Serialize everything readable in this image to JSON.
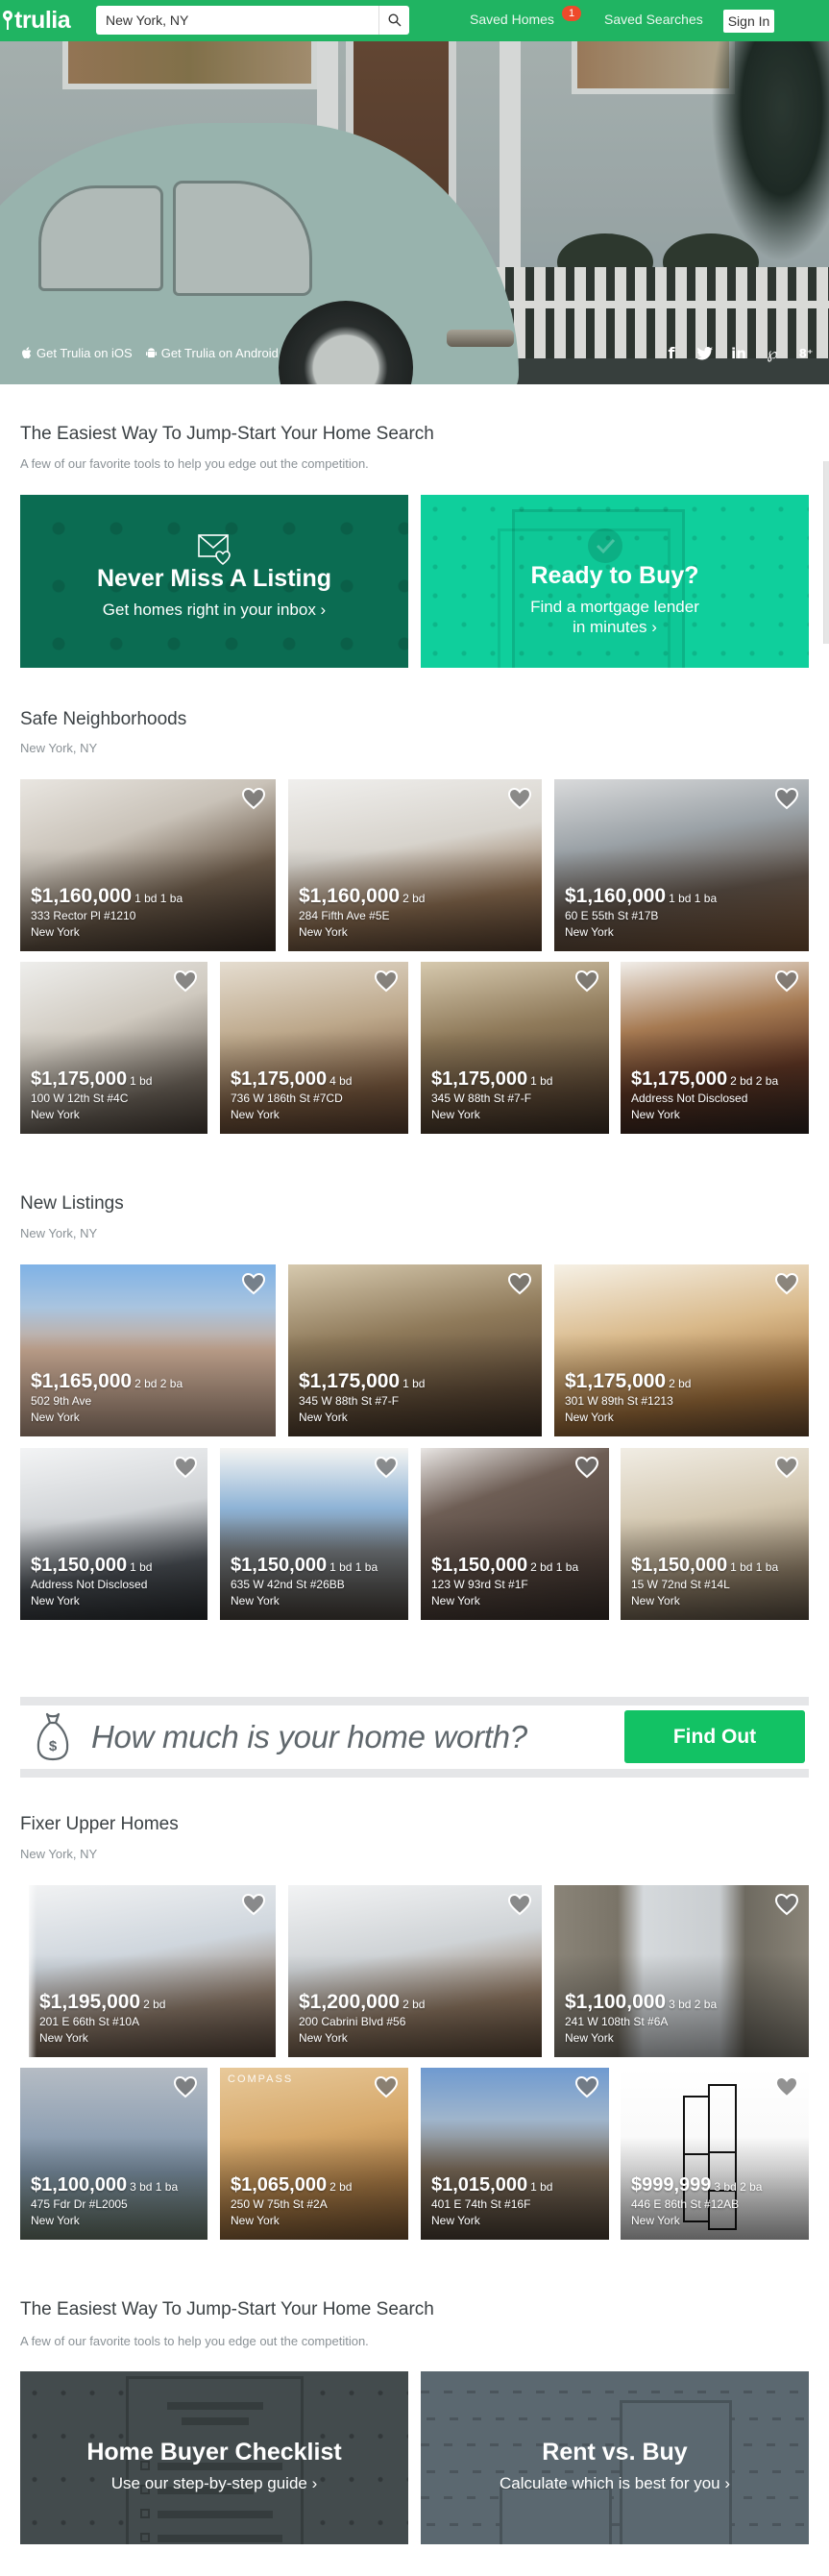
{
  "header": {
    "logo": "trulia",
    "search_value": "New York, NY",
    "search_placeholder": "Search",
    "saved_homes_label": "Saved Homes",
    "saved_homes_count": "1",
    "saved_searches_label": "Saved Searches",
    "sign_in_label": "Sign In",
    "brand_color": "#20b462"
  },
  "hero": {
    "ios_link": "Get Trulia on iOS",
    "android_link": "Get Trulia on Android",
    "social": [
      {
        "icon": "facebook-icon",
        "glyph": "f"
      },
      {
        "icon": "twitter-icon",
        "glyph": "t"
      },
      {
        "icon": "linkedin-icon",
        "glyph": "in"
      },
      {
        "icon": "pinterest-icon",
        "glyph": "P"
      },
      {
        "icon": "google-plus-icon",
        "glyph": "g+"
      }
    ]
  },
  "tools_top": {
    "title": "The Easiest Way To Jump-Start Your Home Search",
    "subtitle": "A few of our favorite tools to help you edge out the competition.",
    "cards": [
      {
        "title": "Never Miss A Listing",
        "subtitle": "Get homes right in your inbox ›",
        "icon": "mail-heart-icon",
        "color": "#0b6c52"
      },
      {
        "title": "Ready to Buy?",
        "subtitle_line1": "Find a mortgage lender",
        "subtitle_line2": "in minutes ›",
        "icon": "check-icon",
        "color": "#0fcf9c"
      }
    ]
  },
  "safe_neighborhoods": {
    "title": "Safe Neighborhoods",
    "subtitle": "New York, NY",
    "listings": [
      {
        "price": "$1,160,000",
        "beds": "1 bd 1 ba",
        "address": "333 Rector Pl #1210",
        "city": "New York"
      },
      {
        "price": "$1,160,000",
        "beds": "2 bd",
        "address": "284 Fifth Ave #5E",
        "city": "New York"
      },
      {
        "price": "$1,160,000",
        "beds": "1 bd 1 ba",
        "address": "60 E 55th St #17B",
        "city": "New York"
      },
      {
        "price": "$1,175,000",
        "beds": "1 bd",
        "address": "100 W 12th St #4C",
        "city": "New York"
      },
      {
        "price": "$1,175,000",
        "beds": "4 bd",
        "address": "736 W 186th St #7CD",
        "city": "New York"
      },
      {
        "price": "$1,175,000",
        "beds": "1 bd",
        "address": "345 W 88th St #7-F",
        "city": "New York"
      },
      {
        "price": "$1,175,000",
        "beds": "2 bd 2 ba",
        "address": "Address Not Disclosed",
        "city": "New York"
      }
    ]
  },
  "new_listings": {
    "title": "New Listings",
    "subtitle": "New York, NY",
    "listings": [
      {
        "price": "$1,165,000",
        "beds": "2 bd 2 ba",
        "address": "502 9th Ave",
        "city": "New York"
      },
      {
        "price": "$1,175,000",
        "beds": "1 bd",
        "address": "345 W 88th St #7-F",
        "city": "New York"
      },
      {
        "price": "$1,175,000",
        "beds": "2 bd",
        "address": "301 W 89th St #1213",
        "city": "New York"
      },
      {
        "price": "$1,150,000",
        "beds": "1 bd",
        "address": "Address Not Disclosed",
        "city": "New York"
      },
      {
        "price": "$1,150,000",
        "beds": "1 bd 1 ba",
        "address": "635 W 42nd St #26BB",
        "city": "New York"
      },
      {
        "price": "$1,150,000",
        "beds": "2 bd 1 ba",
        "address": "123 W 93rd St #1F",
        "city": "New York"
      },
      {
        "price": "$1,150,000",
        "beds": "1 bd 1 ba",
        "address": "15 W 72nd St #14L",
        "city": "New York"
      }
    ]
  },
  "banner": {
    "question": "How much is your home worth?",
    "button_label": "Find Out",
    "button_color": "#12c264"
  },
  "fixer_upper": {
    "title": "Fixer Upper Homes",
    "subtitle": "New York, NY",
    "listings": [
      {
        "price": "$1,195,000",
        "beds": "2 bd",
        "address": "201 E 66th St #10A",
        "city": "New York"
      },
      {
        "price": "$1,200,000",
        "beds": "2 bd",
        "address": "200 Cabrini Blvd #56",
        "city": "New York"
      },
      {
        "price": "$1,100,000",
        "beds": "3 bd 2 ba",
        "address": "241 W 108th St #6A",
        "city": "New York"
      },
      {
        "price": "$1,100,000",
        "beds": "3 bd 1 ba",
        "address": "475 Fdr Dr #L2005",
        "city": "New York"
      },
      {
        "price": "$1,065,000",
        "beds": "2 bd",
        "address": "250 W 75th St #2A",
        "city": "New York"
      },
      {
        "price": "$1,015,000",
        "beds": "1 bd",
        "address": "401 E 74th St #16F",
        "city": "New York"
      },
      {
        "price": "$999,999",
        "beds": "3 bd 2 ba",
        "address": "446 E 86th St #12AB",
        "city": "New York"
      }
    ],
    "watermark_compass": "COMPASS"
  },
  "tools_bottom": {
    "title": "The Easiest Way To Jump-Start Your Home Search",
    "subtitle": "A few of our favorite tools to help you edge out the competition.",
    "cards": [
      {
        "title": "Home Buyer Checklist",
        "subtitle": "Use our step-by-step guide ›",
        "color": "#434b4d"
      },
      {
        "title": "Rent vs. Buy",
        "subtitle": "Calculate which is best for you ›",
        "color": "#5b6870"
      }
    ]
  }
}
